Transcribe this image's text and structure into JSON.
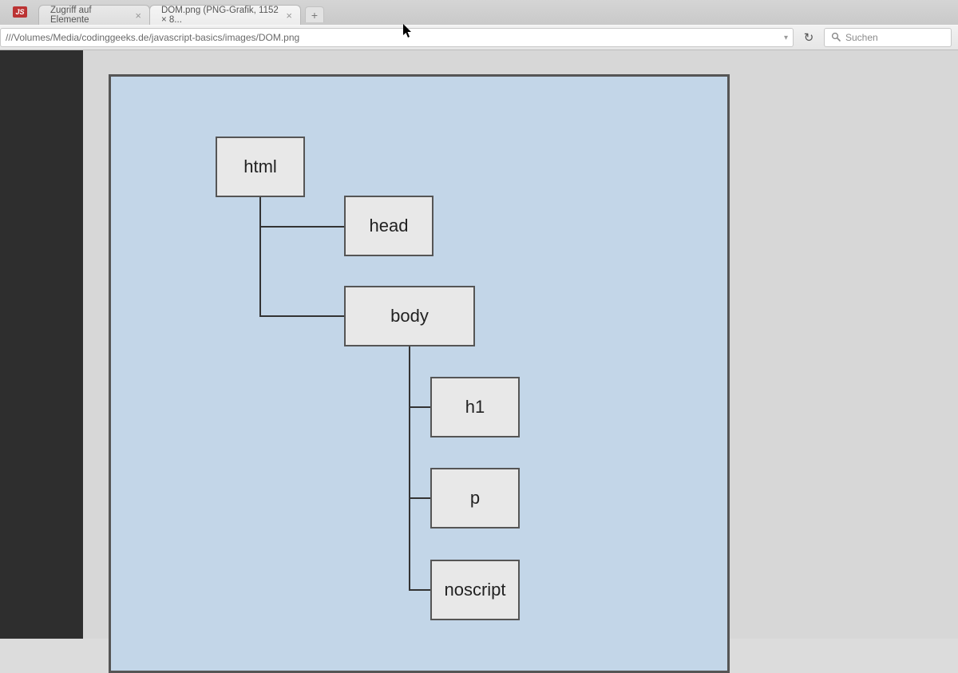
{
  "app_icon_text": "JS",
  "tabs": [
    {
      "label": "Zugriff auf Elemente"
    },
    {
      "label": "DOM.png (PNG-Grafik, 1152 × 8..."
    }
  ],
  "url": "///Volumes/Media/codinggeeks.de/javascript-basics/images/DOM.png",
  "search_placeholder": "Suchen",
  "diagram": {
    "nodes": {
      "html": "html",
      "head": "head",
      "body": "body",
      "h1": "h1",
      "p": "p",
      "noscript": "noscript"
    }
  }
}
